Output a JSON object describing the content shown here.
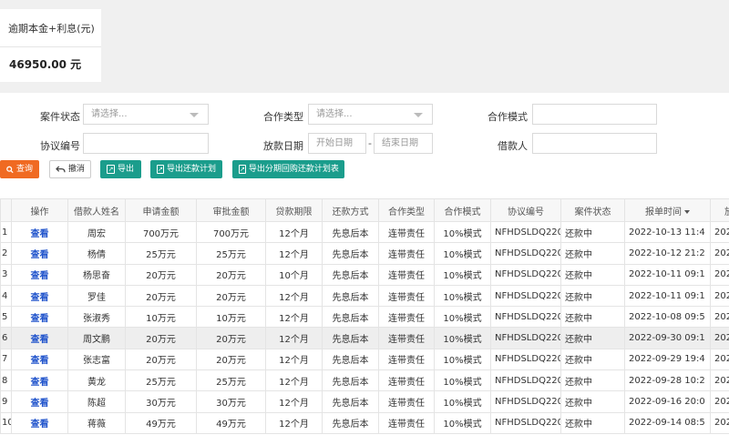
{
  "stat": {
    "label": "逾期本金+利息(元)",
    "value": "46950.00 元"
  },
  "filters": {
    "case_status": {
      "label": "案件状态",
      "placeholder": "请选择..."
    },
    "coop_type": {
      "label": "合作类型",
      "placeholder": "请选择..."
    },
    "coop_mode": {
      "label": "合作模式",
      "value": ""
    },
    "agreement_no": {
      "label": "协议编号",
      "value": ""
    },
    "loan_date": {
      "label": "放款日期",
      "start_placeholder": "开始日期",
      "separator": "-",
      "end_placeholder": "结束日期"
    },
    "borrower": {
      "label": "借款人",
      "value": ""
    }
  },
  "buttons": {
    "query": "查询",
    "reset": "撤消",
    "export": "导出",
    "export_plan": "导出还款计划",
    "export_installment": "导出分期回购还款计划表"
  },
  "table": {
    "headers": [
      "",
      "操作",
      "借款人姓名",
      "申请金额",
      "审批金额",
      "贷款期限",
      "还款方式",
      "合作类型",
      "合作模式",
      "协议编号",
      "案件状态",
      "报单时间",
      "放"
    ],
    "rows": [
      [
        "1",
        "查看",
        "周宏",
        "700万元",
        "700万元",
        "12个月",
        "先息后本",
        "连带责任",
        "10%模式",
        "NFHDSLDQ220",
        "还款中",
        "2022-10-13 11:4",
        "202"
      ],
      [
        "2",
        "查看",
        "杨倩",
        "25万元",
        "25万元",
        "12个月",
        "先息后本",
        "连带责任",
        "10%模式",
        "NFHDSLDQ220",
        "还款中",
        "2022-10-12 21:2",
        "202"
      ],
      [
        "3",
        "查看",
        "杨思奋",
        "20万元",
        "20万元",
        "10个月",
        "先息后本",
        "连带责任",
        "10%模式",
        "NFHDSLDQ220",
        "还款中",
        "2022-10-11 09:1",
        "202"
      ],
      [
        "4",
        "查看",
        "罗佳",
        "20万元",
        "20万元",
        "12个月",
        "先息后本",
        "连带责任",
        "10%模式",
        "NFHDSLDQ220",
        "还款中",
        "2022-10-11 09:1",
        "202"
      ],
      [
        "5",
        "查看",
        "张淑秀",
        "10万元",
        "10万元",
        "12个月",
        "先息后本",
        "连带责任",
        "10%模式",
        "NFHDSLDQ220",
        "还款中",
        "2022-10-08 09:5",
        "202"
      ],
      [
        "6",
        "查看",
        "周文鹏",
        "20万元",
        "20万元",
        "12个月",
        "先息后本",
        "连带责任",
        "10%模式",
        "NFHDSLDQ220",
        "还款中",
        "2022-09-30 09:1",
        "202"
      ],
      [
        "7",
        "查看",
        "张志富",
        "20万元",
        "20万元",
        "12个月",
        "先息后本",
        "连带责任",
        "10%模式",
        "NFHDSLDQ220",
        "还款中",
        "2022-09-29 19:4",
        "202"
      ],
      [
        "8",
        "查看",
        "黄龙",
        "25万元",
        "25万元",
        "12个月",
        "先息后本",
        "连带责任",
        "10%模式",
        "NFHDSLDQ220",
        "还款中",
        "2022-09-28 10:2",
        "202"
      ],
      [
        "9",
        "查看",
        "陈超",
        "30万元",
        "30万元",
        "12个月",
        "先息后本",
        "连带责任",
        "10%模式",
        "NFHDSLDQ220",
        "还款中",
        "2022-09-16 20:0",
        "202"
      ],
      [
        "10",
        "查看",
        "蒋薇",
        "49万元",
        "49万元",
        "12个月",
        "先息后本",
        "连带责任",
        "10%模式",
        "NFHDSLDQ220",
        "还款中",
        "2022-09-14 08:5",
        "202"
      ]
    ],
    "highlighted_row": 6
  },
  "colors": {
    "query": "#f06a22",
    "teal": "#1b9d8c",
    "link": "#2255cc"
  }
}
